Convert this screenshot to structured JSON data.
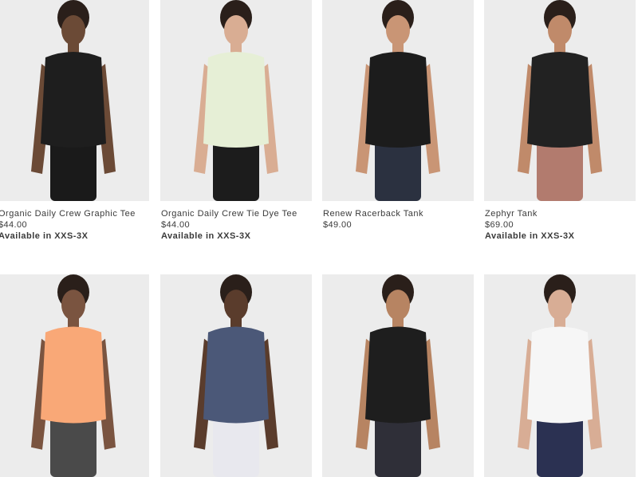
{
  "products": [
    {
      "name": "Organic Daily Crew Graphic Tee",
      "price": "$44.00",
      "availability": "Available in XXS-3X",
      "top_color": "#1e1e1e",
      "bottom_color": "#1a1a1a",
      "skin": "#6b4a36"
    },
    {
      "name": "Organic Daily Crew Tie Dye Tee",
      "price": "$44.00",
      "availability": "Available in XXS-3X",
      "top_color": "#e6efd6",
      "bottom_color": "#1c1c1c",
      "skin": "#d9ad93"
    },
    {
      "name": "Renew Racerback Tank",
      "price": "$49.00",
      "availability": "",
      "top_color": "#1c1c1c",
      "bottom_color": "#2b3140",
      "skin": "#c99575"
    },
    {
      "name": "Zephyr Tank",
      "price": "$69.00",
      "availability": "Available in XXS-3X",
      "top_color": "#222222",
      "bottom_color": "#b27b6e",
      "skin": "#c08a6a"
    },
    {
      "name": "",
      "price": "",
      "availability": "",
      "top_color": "#f9a877",
      "bottom_color": "#4a4a4a",
      "skin": "#7a5440"
    },
    {
      "name": "",
      "price": "",
      "availability": "",
      "top_color": "#4b5878",
      "bottom_color": "#e8e8ee",
      "skin": "#5a3c2c"
    },
    {
      "name": "",
      "price": "",
      "availability": "",
      "top_color": "#1e1e1e",
      "bottom_color": "#2f2f38",
      "skin": "#b78462"
    },
    {
      "name": "",
      "price": "",
      "availability": "",
      "top_color": "#f6f6f6",
      "bottom_color": "#2b3152",
      "skin": "#d8ad95"
    }
  ]
}
